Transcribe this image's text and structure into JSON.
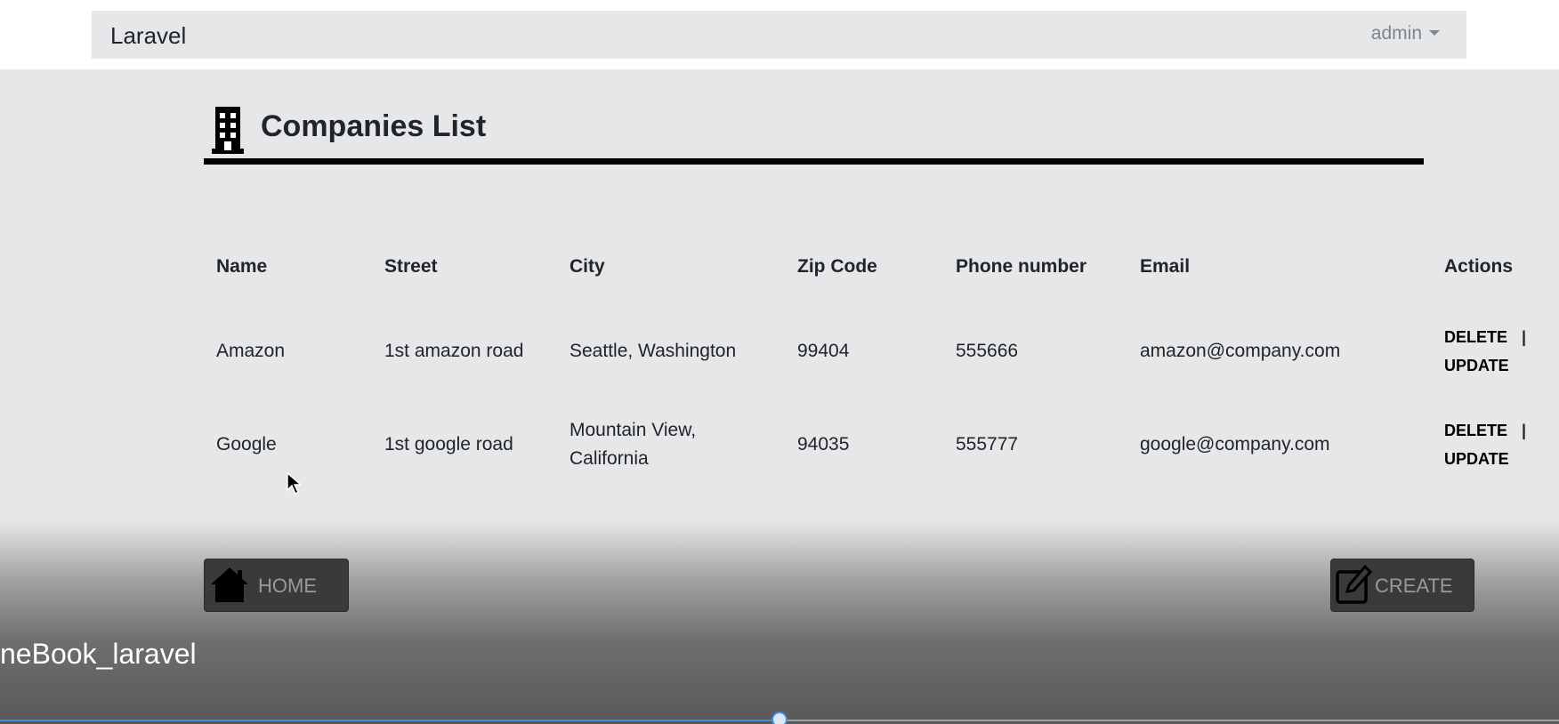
{
  "navbar": {
    "brand": "Laravel",
    "user_menu_label": "admin"
  },
  "page": {
    "title": "Companies List"
  },
  "table": {
    "headers": {
      "name": "Name",
      "street": "Street",
      "city": "City",
      "zip": "Zip Code",
      "phone": "Phone number",
      "email": "Email",
      "actions": "Actions"
    },
    "rows": [
      {
        "name": "Amazon",
        "street": "1st amazon road",
        "city": "Seattle, Washington",
        "zip": "99404",
        "phone": "555666",
        "email": "amazon@company.com",
        "delete_label": "DELETE",
        "separator": "|",
        "update_label": "UPDATE"
      },
      {
        "name": "Google",
        "street": "1st google road",
        "city": "Mountain View, California",
        "zip": "94035",
        "phone": "555777",
        "email": "google@company.com",
        "delete_label": "DELETE",
        "separator": "|",
        "update_label": "UPDATE"
      }
    ]
  },
  "buttons": {
    "home_label": "HOME",
    "create_label": "CREATE"
  },
  "video": {
    "title": "neBook_laravel",
    "progress_fraction": 0.5
  },
  "colors": {
    "accent_progress": "#3e8ede",
    "button_bg": "#3a3a3a",
    "page_bg": "#e6e7e8"
  },
  "icons": {
    "title_icon": "building-icon",
    "home_button_icon": "home-icon",
    "create_button_icon": "edit-icon",
    "user_menu_icon": "caret-down-icon"
  }
}
